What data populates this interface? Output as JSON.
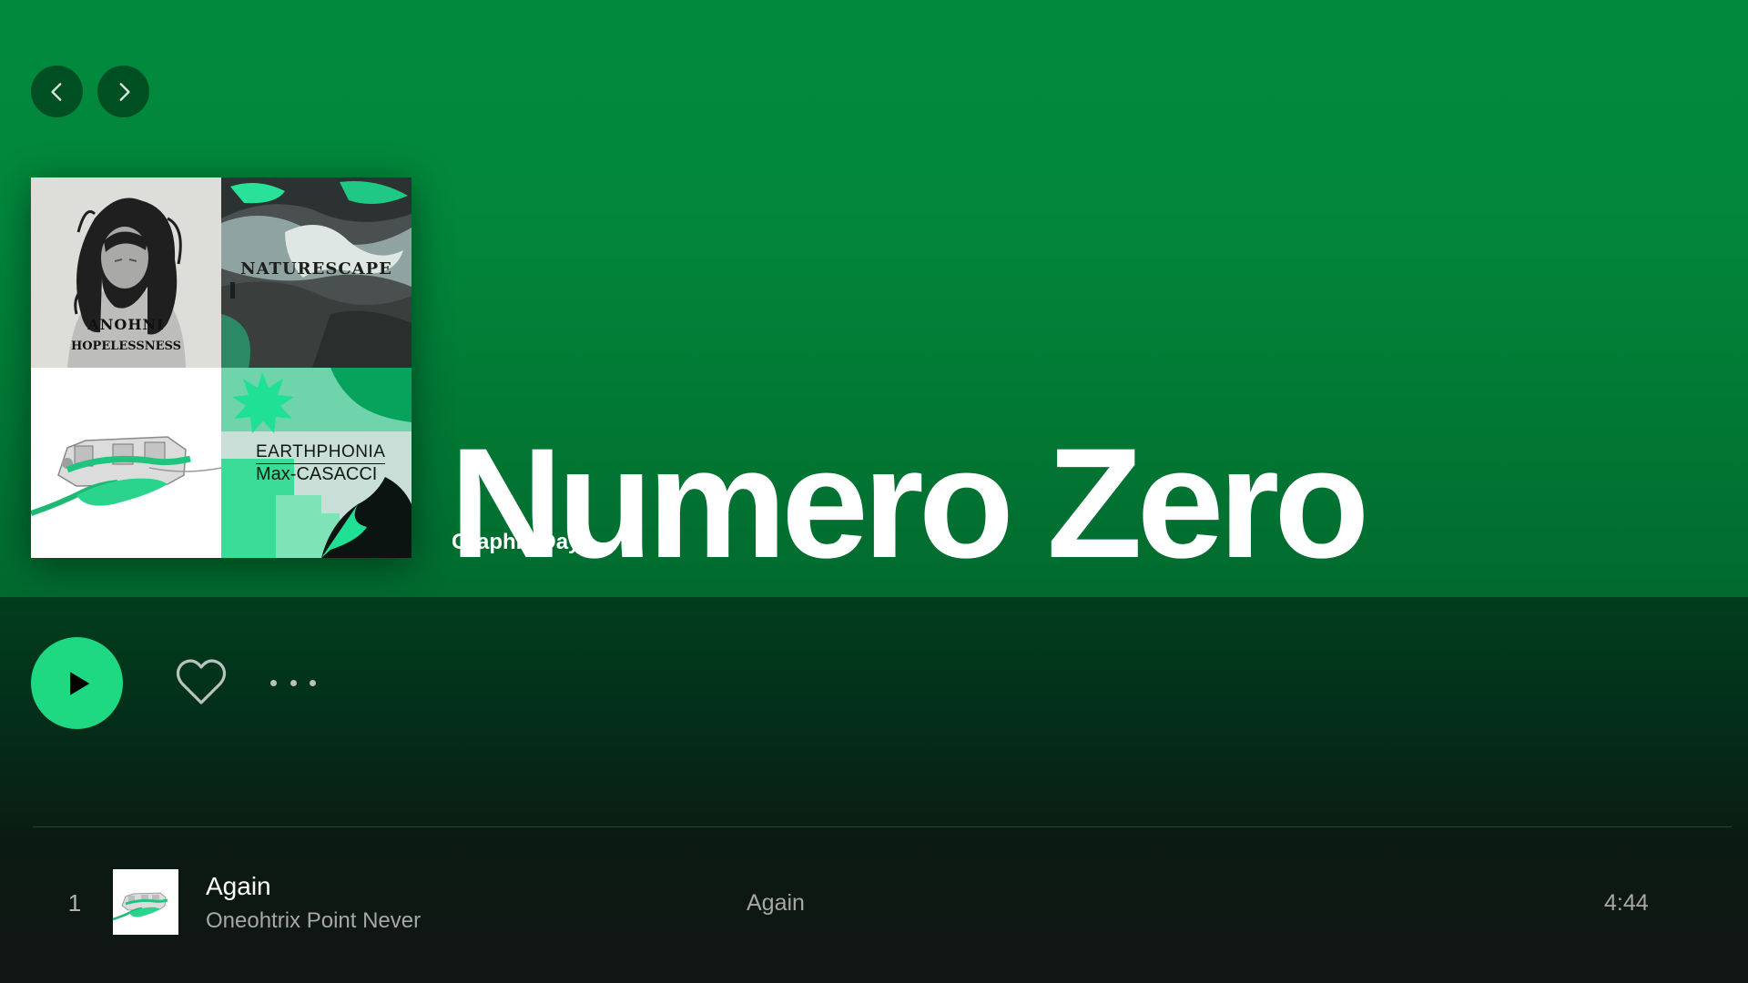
{
  "nav": {
    "back_icon": "chevron-left-icon",
    "forward_icon": "chevron-right-icon"
  },
  "cover": {
    "tiles": [
      {
        "caption_a": "ANOHNI",
        "caption_b": "HOPELESSNESS"
      },
      {
        "caption_a": "NATURESCAPE"
      },
      {},
      {
        "caption_a": "EARTHPHONIA",
        "caption_b": "Max-CASACCI"
      }
    ]
  },
  "playlist": {
    "title": "Numero Zero",
    "owner": "Graphic Days"
  },
  "actions": {
    "play_icon": "play-icon",
    "like_icon": "heart-icon",
    "more_icon": "more-dots-icon"
  },
  "tracks": [
    {
      "number": "1",
      "title": "Again",
      "artist": "Oneohtrix Point Never",
      "album": "Again",
      "duration": "4:44"
    }
  ],
  "colors": {
    "header_green": "#018a3e",
    "accent_green": "#1ed982",
    "muted_text": "#a7a7a7"
  }
}
